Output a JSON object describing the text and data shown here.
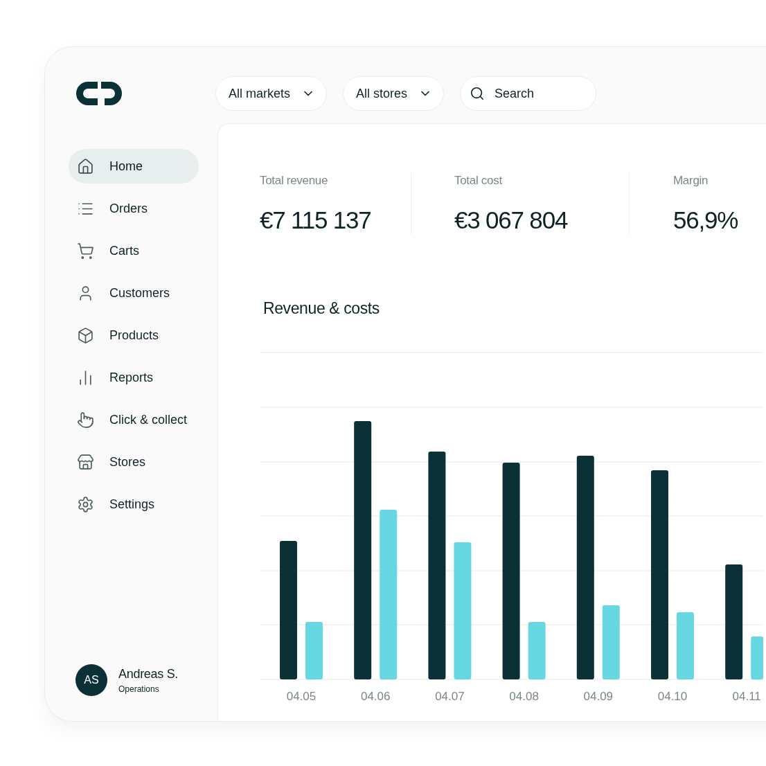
{
  "filters": [
    {
      "kind": "dropdown",
      "label": "All markets"
    },
    {
      "kind": "dropdown",
      "label": "All stores"
    },
    {
      "kind": "search",
      "placeholder": "Search"
    }
  ],
  "sidebar": {
    "items": [
      {
        "label": "Home",
        "selected": true
      },
      {
        "label": "Orders",
        "selected": false
      },
      {
        "label": "Carts",
        "selected": false
      },
      {
        "label": "Customers",
        "selected": false
      },
      {
        "label": "Products",
        "selected": false
      },
      {
        "label": "Reports",
        "selected": false
      },
      {
        "label": "Click & collect",
        "selected": false
      },
      {
        "label": "Stores",
        "selected": false
      },
      {
        "label": "Settings",
        "selected": false
      }
    ],
    "user": {
      "initials": "AS",
      "name": "Andreas S.",
      "role": "Operations"
    }
  },
  "stats": [
    {
      "label": "Total revenue",
      "value": "€7 115 137"
    },
    {
      "label": "Total cost",
      "value": "€3 067 804"
    },
    {
      "label": "Margin",
      "value": "56,9%"
    }
  ],
  "chart": {
    "title": "Revenue & costs",
    "categories": [
      "04.05",
      "04.06",
      "04.07",
      "04.08",
      "04.09",
      "04.10",
      "04.11"
    ]
  }
}
